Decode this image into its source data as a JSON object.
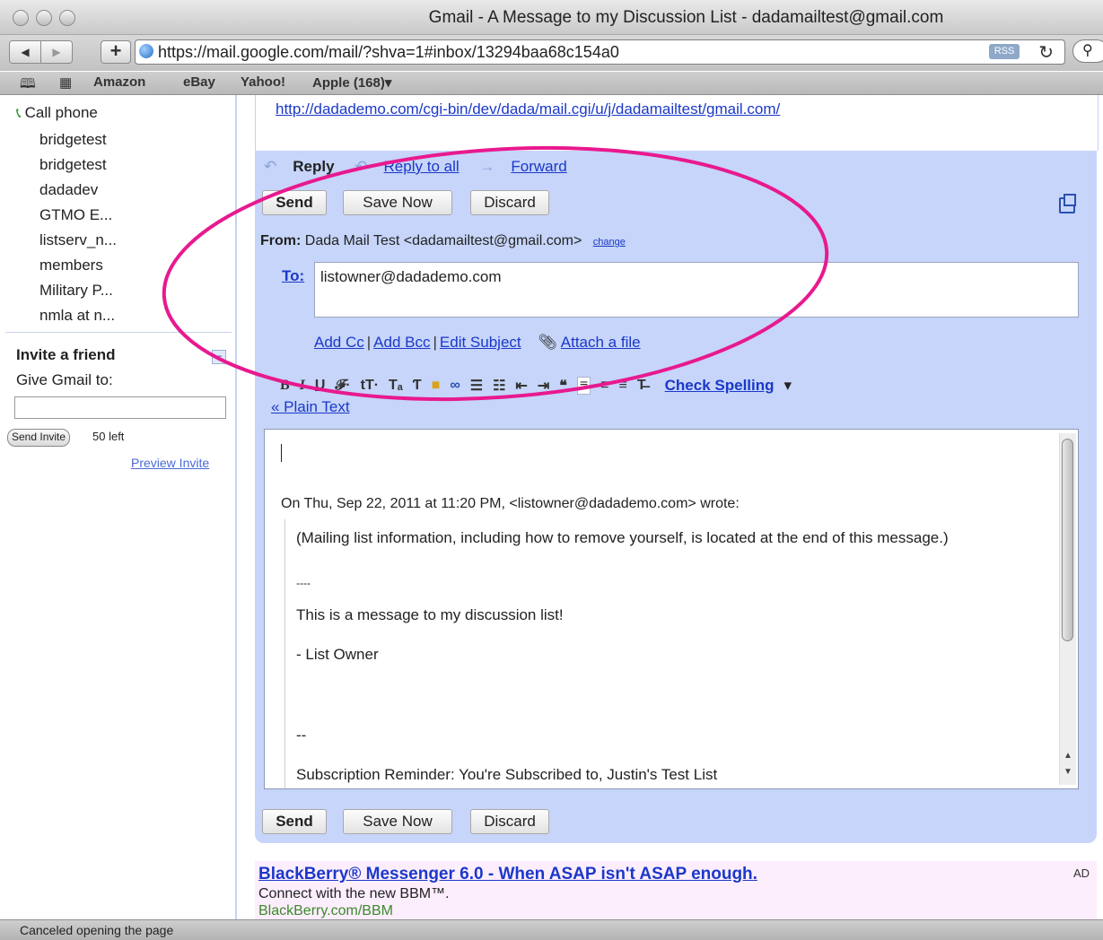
{
  "window": {
    "title": "Gmail - A Message to my Discussion List - dadamailtest@gmail.com"
  },
  "browser": {
    "url": "https://mail.google.com/mail/?shva=1#inbox/13294baa68c154a0",
    "rss_label": "RSS",
    "bookmarks": [
      "Amazon",
      "eBay",
      "Yahoo!",
      "Apple (168)▾"
    ]
  },
  "sidebar": {
    "call_phone": "Call phone",
    "contacts": [
      "bridgetest",
      "bridgetest",
      "dadadev",
      "GTMO E...",
      "listserv_n...",
      "members",
      "Military P...",
      "nmla at n..."
    ],
    "invite": {
      "title": "Invite a friend",
      "label": "Give Gmail to:",
      "send_button": "Send Invite",
      "left_count": "50 left",
      "preview_link": "Preview Invite"
    }
  },
  "message": {
    "link": "http://dadademo.com/cgi-bin/dev/dada/mail.cgi/u/j/dadamailtest/gmail.com/"
  },
  "compose": {
    "reply": "Reply",
    "reply_all": "Reply to all",
    "forward": "Forward",
    "send": "Send",
    "save_now": "Save Now",
    "discard": "Discard",
    "from_label": "From:",
    "from_value": "Dada Mail Test <dadamailtest@gmail.com>",
    "change": "change",
    "to_label": "To:",
    "to_value": "listowner@dadademo.com",
    "add_cc": "Add Cc",
    "add_bcc": "Add Bcc",
    "edit_subject": "Edit Subject",
    "attach_file": "Attach a file",
    "check_spelling": "Check Spelling",
    "plain_text": "« Plain Text",
    "body": {
      "attribution": "On Thu, Sep 22, 2011 at 11:20 PM, <listowner@dadademo.com> wrote:",
      "quote_1": "(Mailing list information, including how to remove yourself, is located at the end of this message.)",
      "dash_1": "----",
      "quote_2": "This is a message to my discussion list!",
      "quote_3": "- List Owner",
      "dash_2": "--",
      "reminder": "Subscription Reminder: You're Subscribed to, Justin's Test List"
    }
  },
  "ad": {
    "title": "BlackBerry® Messenger 6.0 - When ASAP isn't ASAP enough.",
    "tag": "AD",
    "body": "Connect with the new BBM™.",
    "url": "BlackBerry.com/BBM"
  },
  "status": {
    "text": "Canceled opening the page"
  },
  "colors": {
    "accent": "#c6d5f9",
    "link": "#1b38c9",
    "annotation": "#e8198f",
    "ad_bg": "#fdeefd"
  }
}
